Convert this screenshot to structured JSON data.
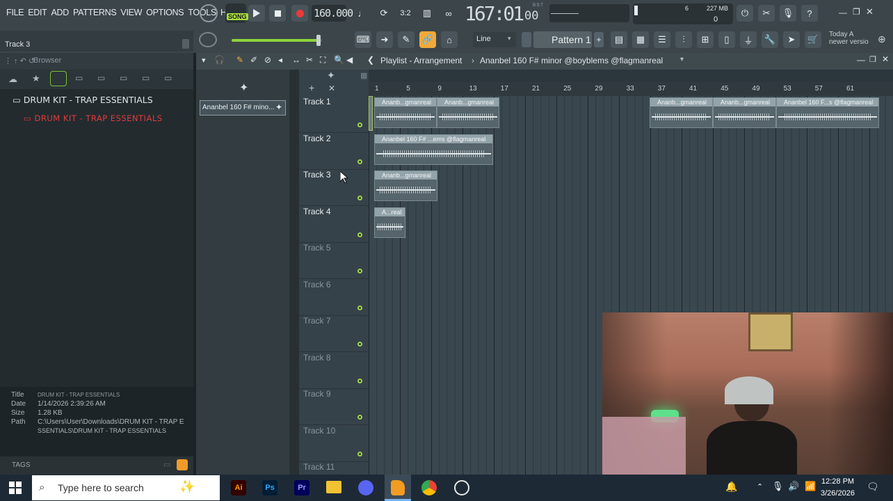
{
  "menu": [
    "FILE",
    "EDIT",
    "ADD",
    "PATTERNS",
    "VIEW",
    "OPTIONS",
    "TOOLS",
    "HELP"
  ],
  "toolbar": {
    "song_label": "SONG",
    "tempo": "160.000",
    "time": "167:01",
    "time_sub": "00",
    "time_small": "B:S:T",
    "cpu_value": "6",
    "memory": "227 MB",
    "poly": "0",
    "hint_track": "Track 3",
    "snap": "Line",
    "pattern": "Pattern 1",
    "news_line1": "Today  A",
    "news_line2": "newer versio"
  },
  "browser": {
    "title": "Browser",
    "folder": "DRUM KIT - TRAP ESSENTIALS",
    "folder_open": "DRUM KIT - TRAP ESSENTIALS",
    "info": {
      "title_label": "Title",
      "title_value": "DRUM KIT - TRAP ESSENTIALS",
      "date_label": "Date",
      "date_value": "1/14/2026 2:39:26 AM",
      "size_label": "Size",
      "size_value": "1.28 KB",
      "path_label": "Path",
      "path_value1": "C:\\Users\\User\\Downloads\\DRUM KIT - TRAP E",
      "path_value2": "SSENTIALS\\DRUM KIT - TRAP ESSENTIALS"
    },
    "tags_label": "TAGS"
  },
  "playlist": {
    "title": "Playlist - Arrangement",
    "pattern_name": "Ananbel 160 F# minor @boyblems @flagmanreal",
    "picker_item": "Ananbel 160 F# mino...",
    "bars": [
      "1",
      "5",
      "9",
      "13",
      "17",
      "21",
      "25",
      "29",
      "33",
      "37",
      "41",
      "45",
      "49",
      "53",
      "57",
      "61"
    ],
    "tracks": [
      "Track 1",
      "Track 2",
      "Track 3",
      "Track 4",
      "Track 5",
      "Track 6",
      "Track 7",
      "Track 8",
      "Track 9",
      "Track 10",
      "Track 11"
    ],
    "clips": {
      "c1": "Ananb...gmanreal",
      "c2": "Ananb...gmanreal",
      "c3": "Ananb...gmanreal",
      "c4": "Ananb...gmanreal",
      "c5": "Ananbel 160 F...s @flagmanreal",
      "c6": "Ananbel 160 F# ...ems @flagmanreal",
      "c7": "Ananb...gmanreal",
      "c8": "A...real"
    }
  },
  "taskbar": {
    "search_placeholder": "Type here to search",
    "time": "12:28 PM",
    "date": "3/26/2026"
  }
}
